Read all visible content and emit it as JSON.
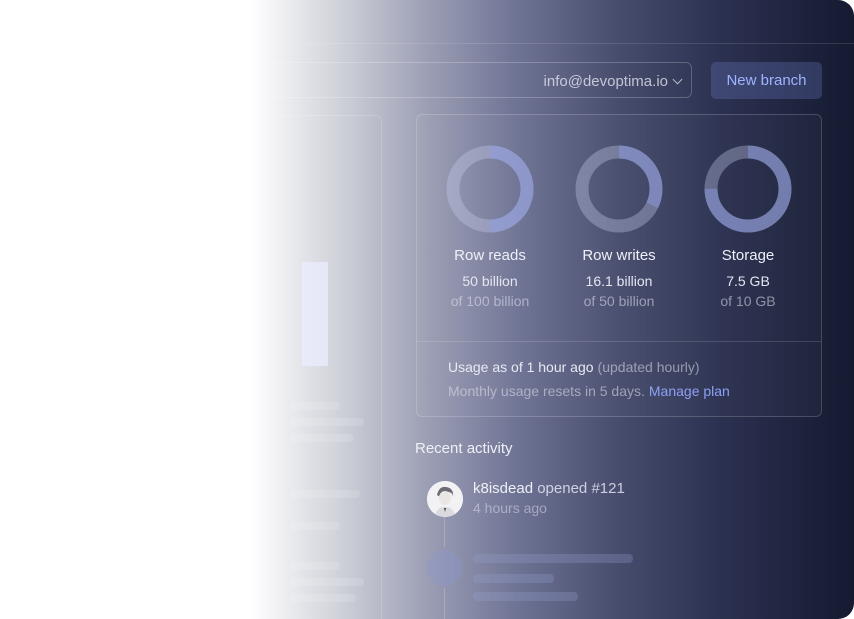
{
  "header": {
    "account_email": "info@devoptima.io",
    "new_branch_label": "New branch"
  },
  "usage": {
    "metrics": [
      {
        "label": "Row reads",
        "value": "50 billion",
        "limit": "of 100 billion",
        "fraction": 0.5
      },
      {
        "label": "Row writes",
        "value": "16.1 billion",
        "limit": "of 50 billion",
        "fraction": 0.322
      },
      {
        "label": "Storage",
        "value": "7.5 GB",
        "limit": "of 10 GB",
        "fraction": 0.75
      }
    ],
    "as_of": "Usage as of 1 hour ago",
    "update_note": "(updated hourly)",
    "reset_note": "Monthly usage resets in 5 days.",
    "manage_plan_label": "Manage plan"
  },
  "recent_activity": {
    "title": "Recent activity",
    "items": [
      {
        "user": "k8isdead",
        "action": "opened #121",
        "time": "4 hours ago"
      }
    ]
  },
  "colors": {
    "accent": "#8ea0f5",
    "ring_track": "#c9cfee",
    "ring_fill": "#8f9de6"
  }
}
